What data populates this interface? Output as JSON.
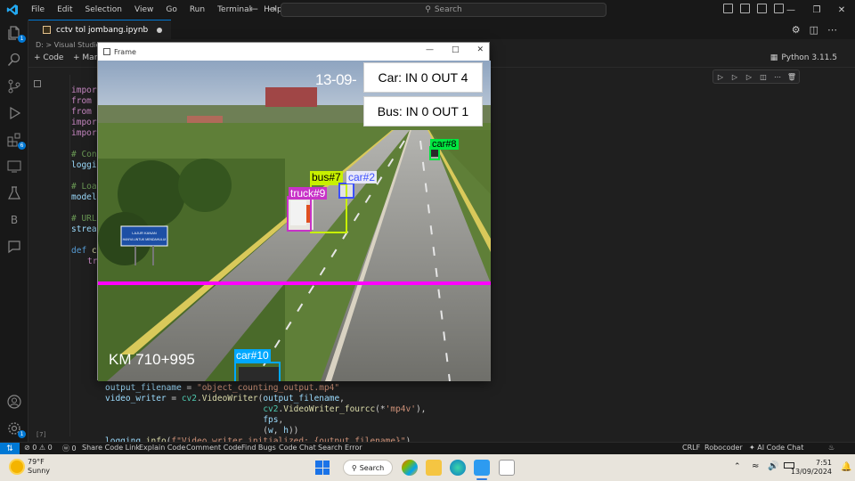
{
  "titlebar": {
    "menu": [
      "File",
      "Edit",
      "Selection",
      "View",
      "Go",
      "Run",
      "Terminal",
      "Help"
    ],
    "search_placeholder": "Search"
  },
  "activity_badges": {
    "explorer": "1",
    "extensions": "6",
    "accounts": "1"
  },
  "tab": {
    "label": "cctv tol jombang.ipynb"
  },
  "breadcrumb": "D: > Visual Studio",
  "notebook_toolbar": {
    "code_label": "Code",
    "markdown_label": "Mark",
    "kernel_label": "Python 3.11.5"
  },
  "code": {
    "lines_top": [
      {
        "kw": "import",
        "rest": ""
      },
      {
        "kw": "from",
        "rest": " u"
      },
      {
        "kw": "from",
        "rest": " u"
      },
      {
        "kw": "import",
        "rest": ""
      },
      {
        "kw": "import",
        "rest": ""
      }
    ],
    "comment_conf": "# Conf",
    "logging_frag": "loggin",
    "comment_load": "# Load",
    "model_frag": "model",
    "comment_url": "# URL",
    "stream_frag": "stream",
    "def_frag": "def",
    "def_name": "cap",
    "try_frag": "tr",
    "bottom_lines": [
      "output_filename = \"object_counting_output.mp4\"",
      "video_writer = cv2.VideoWriter(output_filename,",
      "                               cv2.VideoWriter_fourcc(*'mp4v'),",
      "                               fps,",
      "                               (w, h))",
      "logging.info(f\"Video writer initialized: {output_filename}\")"
    ],
    "cell_exec_label": "[7]"
  },
  "frame_window": {
    "title": "Frame",
    "timestamp": "13-09-",
    "car_counter": "Car: IN 0 OUT 4",
    "bus_counter": "Bus: IN 0 OUT 1",
    "km_marker": "KM 710+995",
    "sign_text_1": "LAJUR KANAN",
    "sign_text_2": "HANYA UNTUK MENDAHULUI",
    "detections": [
      {
        "label": "car#8",
        "color": "#00e640"
      },
      {
        "label": "bus#7",
        "color": "#c8f000"
      },
      {
        "label": "car#2",
        "color": "#3c50ff"
      },
      {
        "label": "truck#9",
        "color": "#c832c8"
      },
      {
        "label": "car#10",
        "color": "#00a8ff"
      }
    ],
    "line_color": "#ff00ff"
  },
  "statusbar": {
    "problems": "⊘ 0 ⚠ 0",
    "ports": "ⓦ 0",
    "items_left": [
      "Share Code Link",
      "Explain Code",
      "Comment Code",
      "Find Bugs",
      "Code Chat",
      "Search Error"
    ],
    "items_right": [
      "CRLF",
      "Robocoder",
      "AI Code Chat"
    ]
  },
  "taskbar": {
    "temp": "79°F",
    "condition": "Sunny",
    "search_label": "Search",
    "time": "7:51",
    "date": "13/09/2024"
  }
}
